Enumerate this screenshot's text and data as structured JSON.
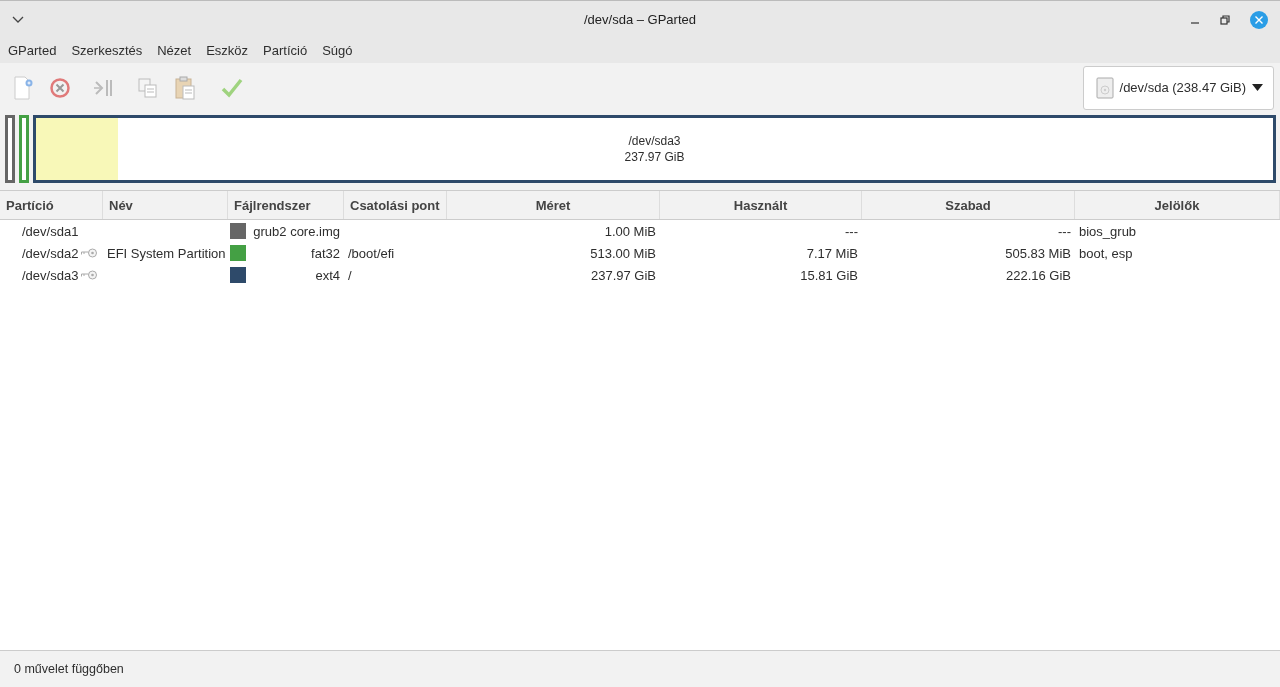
{
  "window": {
    "title": "/dev/sda – GParted"
  },
  "menu": [
    "GParted",
    "Szerkesztés",
    "Nézet",
    "Eszköz",
    "Partíció",
    "Súgó"
  ],
  "device_selector": {
    "value": "/dev/sda (238.47 GiB)"
  },
  "disk_map": [
    {
      "color": "#666666"
    },
    {
      "color": "#44a044"
    },
    {
      "color": "#2e4a6a",
      "label": "/dev/sda3",
      "size": "237.97 GiB",
      "level": 0.066
    }
  ],
  "table": {
    "columns": [
      "Partíció",
      "Név",
      "Fájlrendszer",
      "Csatolási pont",
      "Méret",
      "Használt",
      "Szabad",
      "Jelölők"
    ],
    "rows": [
      {
        "partition": "/dev/sda1",
        "mounted": false,
        "name": "",
        "color": "#666666",
        "filesystem": "grub2 core.img",
        "mount_point": "",
        "size": "1.00 MiB",
        "used": "---",
        "free": "---",
        "flags": "bios_grub"
      },
      {
        "partition": "/dev/sda2",
        "mounted": true,
        "name": "EFI System Partition",
        "color": "#44a044",
        "filesystem": "fat32",
        "mount_point": "/boot/efi",
        "size": "513.00 MiB",
        "used": "7.17 MiB",
        "free": "505.83 MiB",
        "flags": "boot, esp"
      },
      {
        "partition": "/dev/sda3",
        "mounted": true,
        "name": "",
        "color": "#2e4a6a",
        "filesystem": "ext4",
        "mount_point": "/",
        "size": "237.97 GiB",
        "used": "15.81 GiB",
        "free": "222.16 GiB",
        "flags": ""
      }
    ]
  },
  "status_bar": "0 művelet függőben"
}
